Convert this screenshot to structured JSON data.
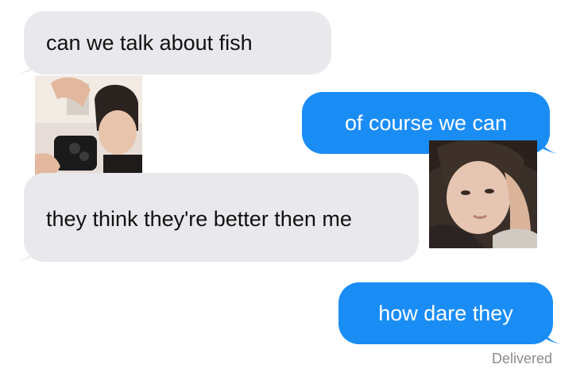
{
  "messages": [
    {
      "direction": "received",
      "text": "can we talk about fish"
    },
    {
      "direction": "sent",
      "text": "of course we can"
    },
    {
      "direction": "received",
      "text": "they think they're better then me"
    },
    {
      "direction": "sent",
      "text": "how dare they"
    }
  ],
  "status": {
    "delivered": "Delivered"
  },
  "colors": {
    "sent_bubble": "#1a8df5",
    "received_bubble": "#e9e9ed",
    "status_text": "#8a8a8e"
  }
}
